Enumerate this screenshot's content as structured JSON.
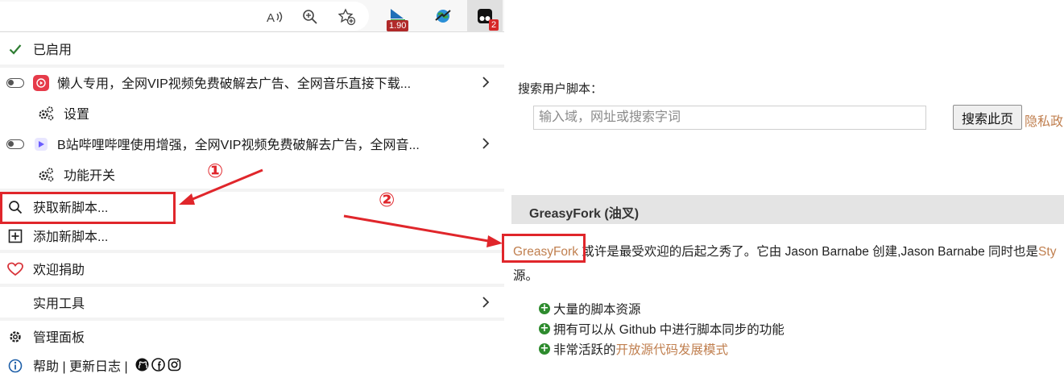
{
  "toolbar": {
    "icons": [
      "read-aloud-icon",
      "zoom-icon",
      "favorite-add-icon"
    ],
    "ext_badge_1": "1.90",
    "ext_badge_2": "2"
  },
  "menu": {
    "enabled_label": "已启用",
    "scripts": [
      {
        "name": "懒人专用，全网VIP视频免费破解去广告、全网音乐直接下载...",
        "sub_label": "设置"
      },
      {
        "name": "B站哔哩哔哩使用增强，全网VIP视频免费破解去广告，全网音...",
        "sub_label": "功能开关"
      }
    ],
    "get_new_scripts": "获取新脚本...",
    "add_new_script": "添加新脚本...",
    "donate": "欢迎捐助",
    "utilities": "实用工具",
    "dashboard": "管理面板",
    "help_line": "帮助 | 更新日志 |"
  },
  "annotations": {
    "circle_1": "①",
    "circle_2": "②"
  },
  "page": {
    "search_label": "搜索用户脚本：",
    "search_placeholder": "输入域，网址或搜索字词",
    "search_button": "搜索此页",
    "privacy_link": "隐私政",
    "section_title": "GreasyFork (油叉)",
    "para_link": "GreasyFork",
    "para_text": " 或许是最受欢迎的后起之秀了。它由 Jason Barnabe 创建,Jason Barnabe 同时也是",
    "para_tail_link": "Sty",
    "para_line2": "源。",
    "features": [
      {
        "text": "大量的脚本资源",
        "link": ""
      },
      {
        "text": "拥有可以从 Github 中进行脚本同步的功能",
        "link": ""
      },
      {
        "text": "非常活跃的",
        "link": "开放源代码发展模式"
      }
    ]
  },
  "colors": {
    "accent_link": "#c07f4f",
    "annotation_red": "#e0262b",
    "check_green": "#2e7d32"
  }
}
